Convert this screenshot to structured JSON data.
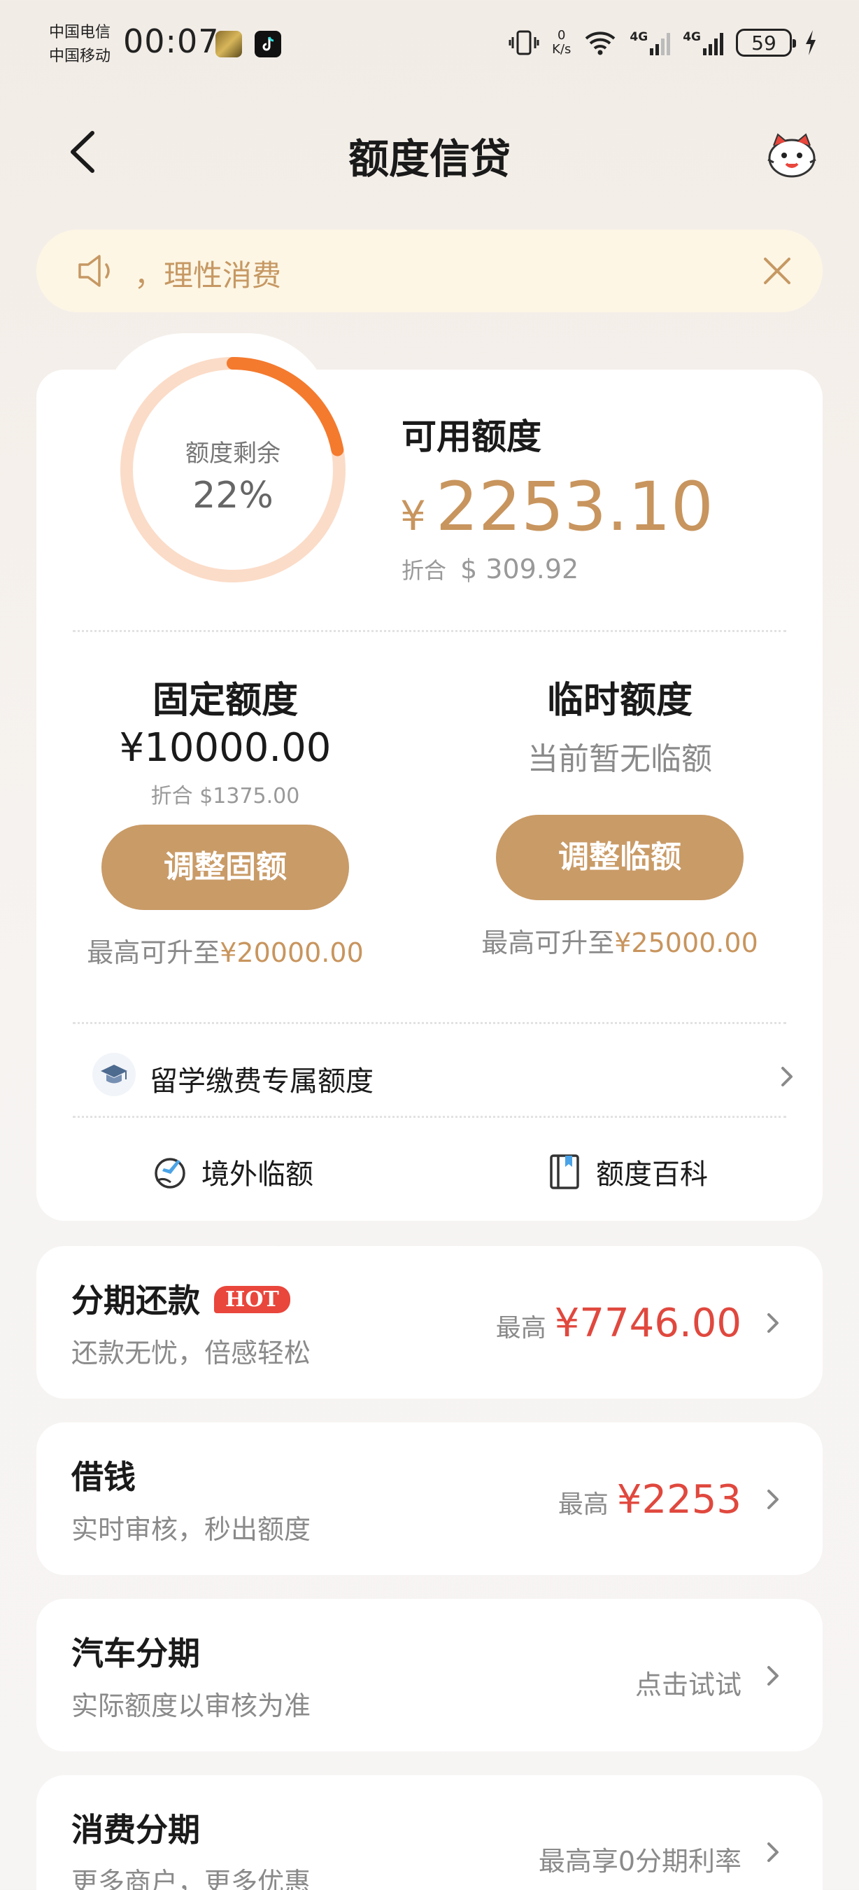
{
  "status_bar": {
    "carrier_1": "中国电信",
    "carrier_2": "中国移动",
    "time": "00:07",
    "speed_value": "0",
    "speed_unit": "K/s",
    "network_1": "4G",
    "network_2": "4G",
    "battery": "59"
  },
  "header": {
    "title": "额度信贷"
  },
  "notice": {
    "text": "，理性消费"
  },
  "quota": {
    "ring_label": "额度剩余",
    "ring_value": "22%",
    "remaining_fraction": 0.22,
    "available_label": "可用额度",
    "currency_symbol": "¥",
    "available_amount": "2253.10",
    "usd_label": "折合",
    "usd_amount": "$ 309.92"
  },
  "fixed": {
    "title": "固定额度",
    "amount": "¥10000.00",
    "usd": "折合 $1375.00",
    "button": "调整固额",
    "cap_prefix": "最高可升至",
    "cap_value": "¥20000.00"
  },
  "temporary": {
    "title": "临时额度",
    "none_text": "当前暂无临额",
    "button": "调整临额",
    "cap_prefix": "最高可升至",
    "cap_value": "¥25000.00"
  },
  "study_abroad": {
    "label": "留学缴费专属额度"
  },
  "links": {
    "overseas": "境外临额",
    "wiki": "额度百科"
  },
  "products": [
    {
      "title": "分期还款",
      "badge": "HOT",
      "subtitle": "还款无忧，倍感轻松",
      "value_label": "最高",
      "value": "¥7746.00"
    },
    {
      "title": "借钱",
      "subtitle": "实时审核，秒出额度",
      "value_label": "最高",
      "value": "¥2253"
    },
    {
      "title": "汽车分期",
      "subtitle": "实际额度以审核为准",
      "hint": "点击试试"
    },
    {
      "title": "消费分期",
      "subtitle": "更多商户，更多优惠",
      "hint": "最高享0分期利率"
    }
  ],
  "colors": {
    "gold": "#c8955e",
    "button_gold": "#c99b67",
    "ring_orange": "#f47a2e",
    "ring_track": "#fbdcc8",
    "red": "#e0483e",
    "notice_bg": "#fdf6e5"
  }
}
